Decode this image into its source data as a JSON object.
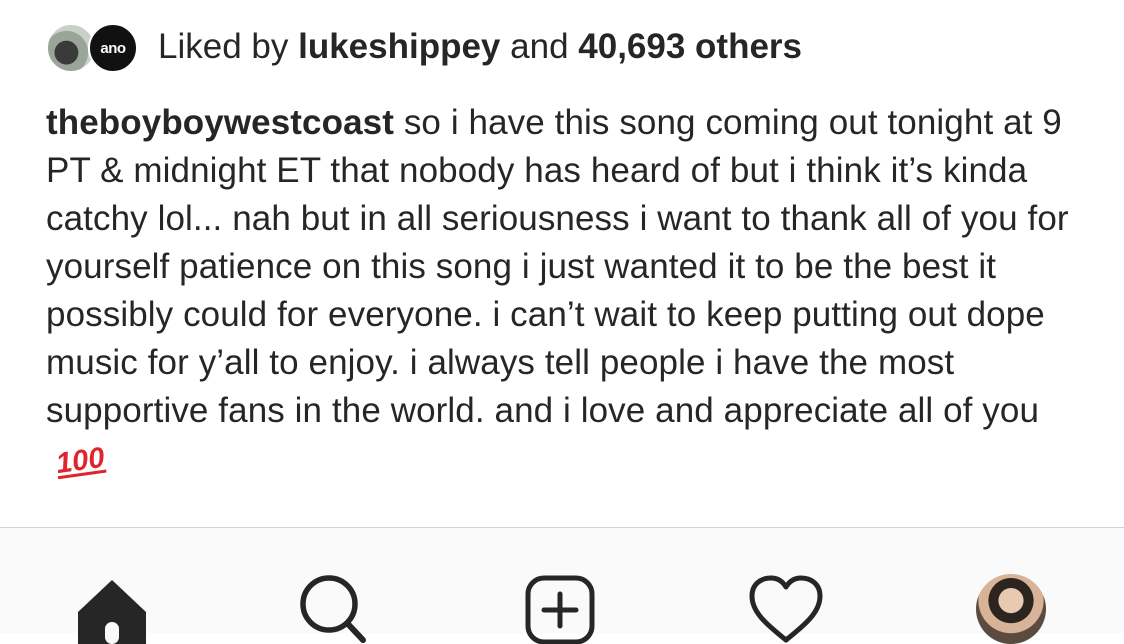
{
  "likes": {
    "avatar2_text": "ano",
    "prefix": "Liked by",
    "liker": "lukeshippey",
    "middle": "and",
    "count": "40,693 others"
  },
  "caption": {
    "username": "theboyboywestcoast",
    "text": "so i have this song coming out tonight at 9 PT & midnight ET that nobody has heard of but i think it’s kinda catchy lol... nah but in all seriousness i want to thank all of you for yourself patience on this song i just wanted it to be the best it possibly could for everyone. i can’t wait to keep putting out dope music for y’all to enjoy. i always tell people i have the most supportive fans in the world. and i love and appreciate all of you",
    "emoji": "100"
  },
  "tab_bar": {
    "tabs": [
      {
        "name": "home",
        "icon": "home-icon"
      },
      {
        "name": "search",
        "icon": "search-icon"
      },
      {
        "name": "new-post",
        "icon": "plus-square-icon"
      },
      {
        "name": "activity",
        "icon": "heart-icon"
      },
      {
        "name": "profile",
        "icon": "profile-avatar"
      }
    ]
  },
  "colors": {
    "text": "#262626",
    "emoji_red": "#e0242c",
    "tab_bar_bg": "#fafafa",
    "divider": "#d4d4d4"
  }
}
